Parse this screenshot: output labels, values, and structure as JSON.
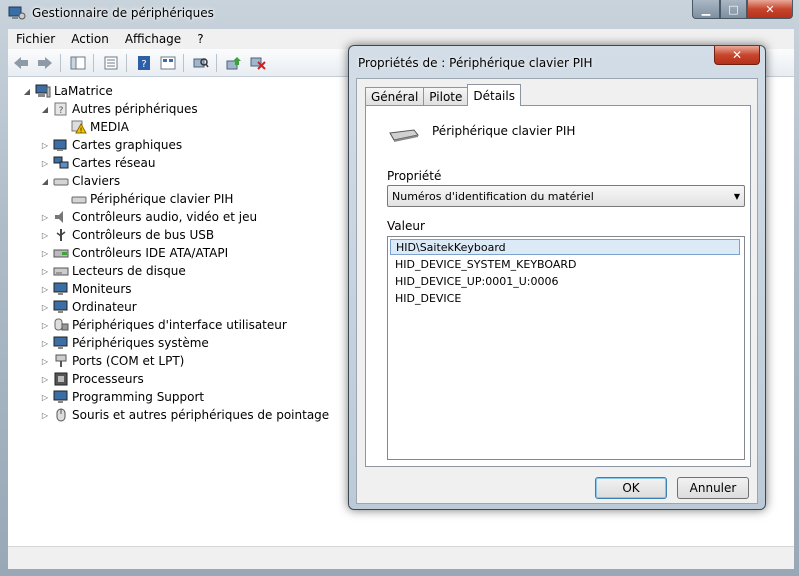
{
  "window": {
    "title": "Gestionnaire de périphériques",
    "icon": "device-manager-icon"
  },
  "menu": [
    "Fichier",
    "Action",
    "Affichage",
    "?"
  ],
  "toolbar": {
    "buttons": [
      "back-icon",
      "forward-icon",
      "show-hide-tree-icon",
      "properties-icon",
      "help-icon",
      "view-icon",
      "scan-hardware-icon",
      "update-driver-icon",
      "uninstall-icon"
    ]
  },
  "tree": {
    "root": "LaMatrice",
    "nodes": [
      {
        "label": "Autres périphériques",
        "expanded": true,
        "level": 1
      },
      {
        "label": "MEDIA",
        "level": 2,
        "icon": "warning-icon"
      },
      {
        "label": "Cartes graphiques",
        "level": 1
      },
      {
        "label": "Cartes réseau",
        "level": 1
      },
      {
        "label": "Claviers",
        "expanded": true,
        "level": 1
      },
      {
        "label": "Périphérique clavier PIH",
        "level": 2
      },
      {
        "label": "Contrôleurs audio, vidéo et jeu",
        "level": 1
      },
      {
        "label": "Contrôleurs de bus USB",
        "level": 1
      },
      {
        "label": "Contrôleurs IDE ATA/ATAPI",
        "level": 1
      },
      {
        "label": "Lecteurs de disque",
        "level": 1
      },
      {
        "label": "Moniteurs",
        "level": 1
      },
      {
        "label": "Ordinateur",
        "level": 1
      },
      {
        "label": "Périphériques d'interface utilisateur",
        "level": 1
      },
      {
        "label": "Périphériques système",
        "level": 1
      },
      {
        "label": "Ports (COM et LPT)",
        "level": 1
      },
      {
        "label": "Processeurs",
        "level": 1
      },
      {
        "label": "Programming Support",
        "level": 1
      },
      {
        "label": "Souris et autres périphériques de pointage",
        "level": 1
      }
    ]
  },
  "dialog": {
    "title": "Propriétés de : Périphérique clavier PIH",
    "close": "✕",
    "tabs": [
      "Général",
      "Pilote",
      "Détails"
    ],
    "active_tab": "Détails",
    "device_name": "Périphérique clavier PIH",
    "property_label": "Propriété",
    "property_value": "Numéros d'identification du matériel",
    "value_label": "Valeur",
    "values": [
      "HID\\SaitekKeyboard",
      "HID_DEVICE_SYSTEM_KEYBOARD",
      "HID_DEVICE_UP:0001_U:0006",
      "HID_DEVICE"
    ],
    "selected_value": 0,
    "ok": "OK",
    "cancel": "Annuler"
  }
}
